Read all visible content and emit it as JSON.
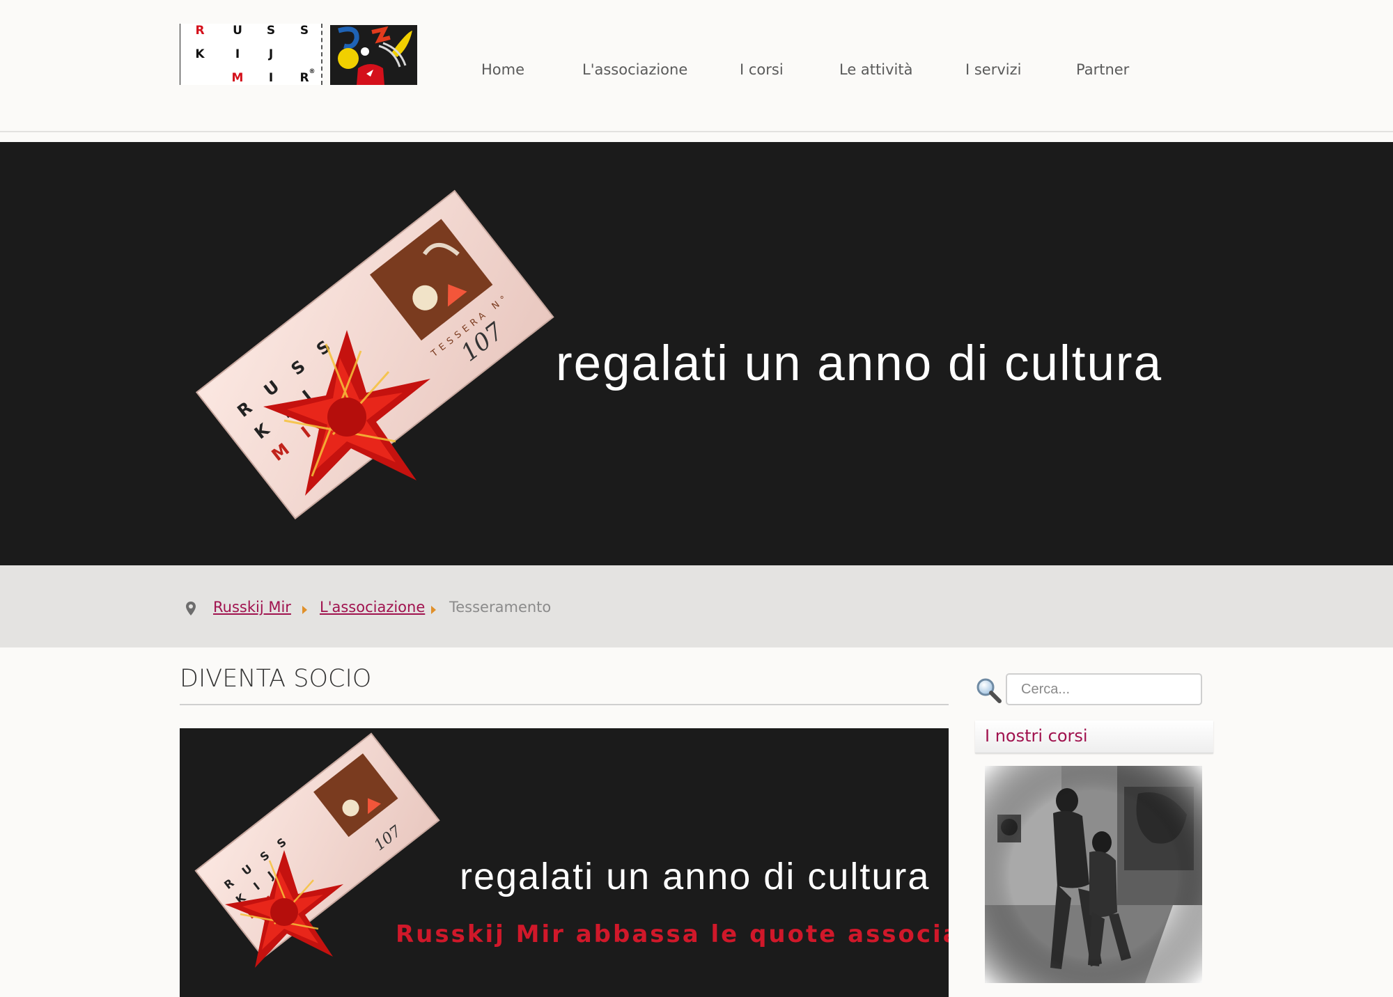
{
  "logo": {
    "letters": [
      "R",
      "U",
      "S",
      "S",
      "K",
      "I",
      "J",
      "M",
      "I",
      "R"
    ],
    "registered": "®"
  },
  "nav": {
    "items": [
      "Home",
      "L'associazione",
      "I corsi",
      "Le attività",
      "I servizi",
      "Partner"
    ]
  },
  "hero": {
    "text": "regalati un anno di cultura",
    "card_text": [
      "R U S S",
      "K I J",
      "M I R",
      "TESSERA N°",
      "107"
    ]
  },
  "breadcrumb": {
    "items": [
      "Russkij Mir",
      "L'associazione",
      "Tesseramento"
    ]
  },
  "main": {
    "title": "DIVENTA SOCIO",
    "image_text": "regalati un anno di cultura",
    "image_subtext": "Russkij Mir abbassa le quote associative!"
  },
  "sidebar": {
    "search_placeholder": "Cerca...",
    "module_title": "I nostri corsi"
  },
  "colors": {
    "accent": "#a0124e",
    "crumb_arrow": "#e0902a",
    "hero_bg": "#1b1b1b",
    "subtext": "#d0182a"
  }
}
